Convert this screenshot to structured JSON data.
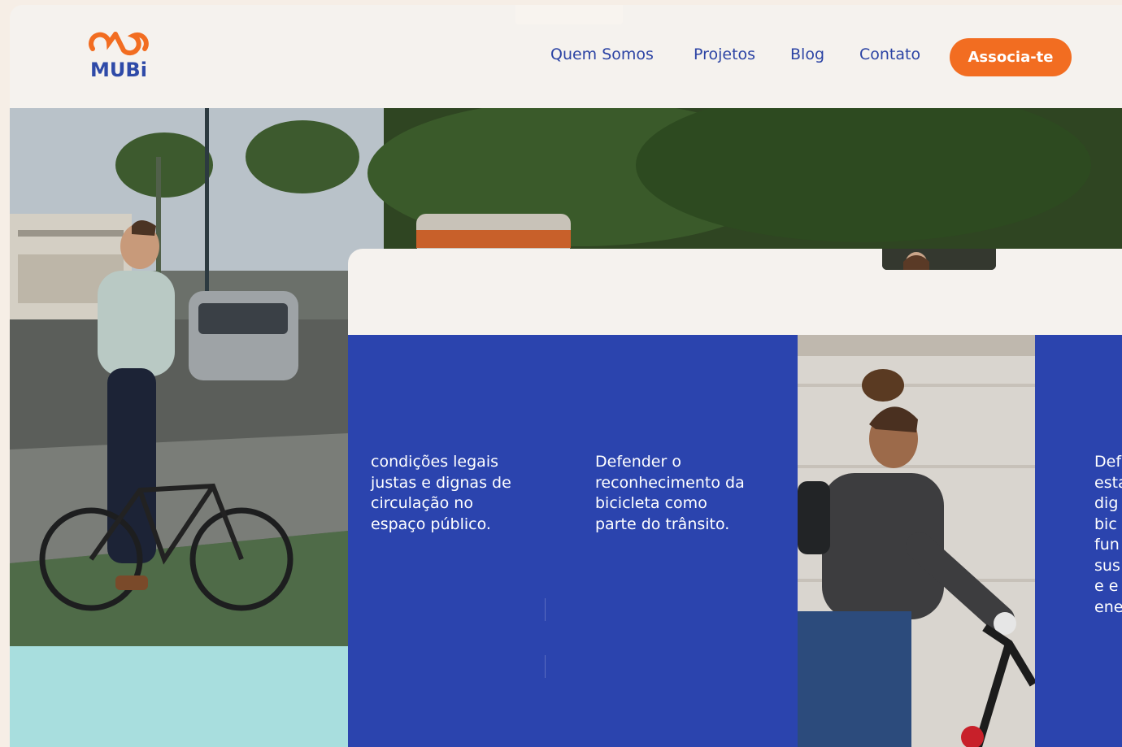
{
  "brand": {
    "name": "MUBi",
    "colors": {
      "primary_blue": "#2b44ae",
      "accent_orange": "#f26d21",
      "background": "#f5f2ee",
      "mint": "#a8dede"
    }
  },
  "nav": {
    "items": [
      {
        "label": "Quem Somos"
      },
      {
        "label": "Projetos"
      },
      {
        "label": "Blog"
      },
      {
        "label": "Contato"
      }
    ],
    "cta_label": "Associa-te"
  },
  "hero": {
    "image": "man-cycling-city-street-photo"
  },
  "mission": {
    "columns": [
      {
        "text": "condições legais\njustas e dignas de\ncirculação no\nespaço público."
      },
      {
        "text": "Defender o\nreconhecimento da\nbicicleta como\nparte do trânsito."
      },
      {
        "text": "Def\nesta\ndig\nbic\nfun\nsus\ne e\nene"
      }
    ],
    "image": "woman-cycling-smiling-photo"
  }
}
